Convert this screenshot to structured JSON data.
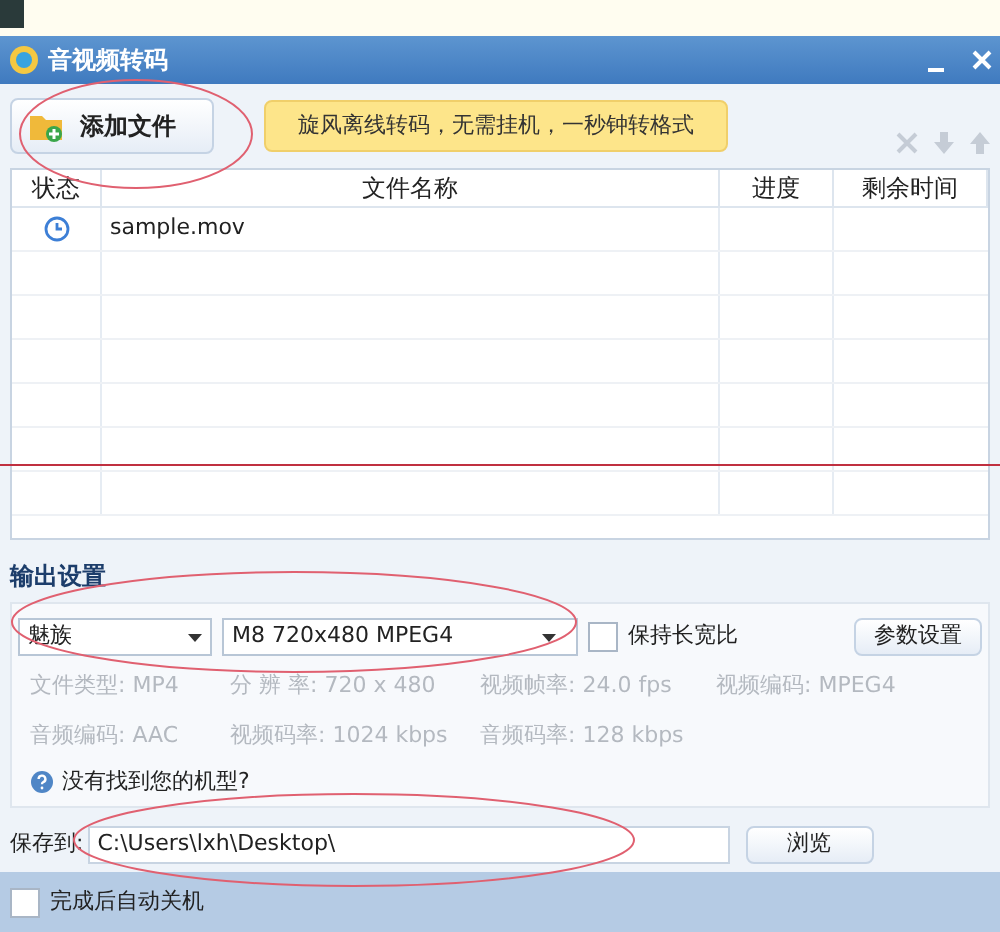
{
  "window": {
    "title": "音视频转码"
  },
  "toolbar": {
    "add_button": "添加文件",
    "promo": "旋风离线转码，无需挂机，一秒钟转格式"
  },
  "table": {
    "columns": [
      "状态",
      "文件名称",
      "进度",
      "剩余时间"
    ],
    "rows": [
      {
        "kind": "waiting",
        "name": "sample.mov"
      }
    ]
  },
  "output": {
    "heading": "输出设置",
    "brand": "魅族",
    "preset": "M8 720x480 MPEG4",
    "keep_ratio": {
      "label": "保持长宽比",
      "checked": false
    },
    "params_button": "参数设置",
    "specs": [
      {
        "label": "文件类型:",
        "value": "MP4"
      },
      {
        "label": "分 辨 率:",
        "value": "720 x 480"
      },
      {
        "label": "视频帧率:",
        "value": "24.0 fps"
      },
      {
        "label": "视频编码:",
        "value": "MPEG4"
      },
      {
        "label": "音频编码:",
        "value": "AAC"
      },
      {
        "label": "视频码率:",
        "value": "1024 kbps"
      },
      {
        "label": "音频码率:",
        "value": "128 kbps"
      }
    ],
    "help": "没有找到您的机型?"
  },
  "save": {
    "label": "保存到:",
    "path": "C:\\Users\\lxh\\Desktop\\",
    "browse": "浏览"
  },
  "footer": {
    "shutdown": {
      "label": "完成后自动关机",
      "checked": false
    }
  }
}
